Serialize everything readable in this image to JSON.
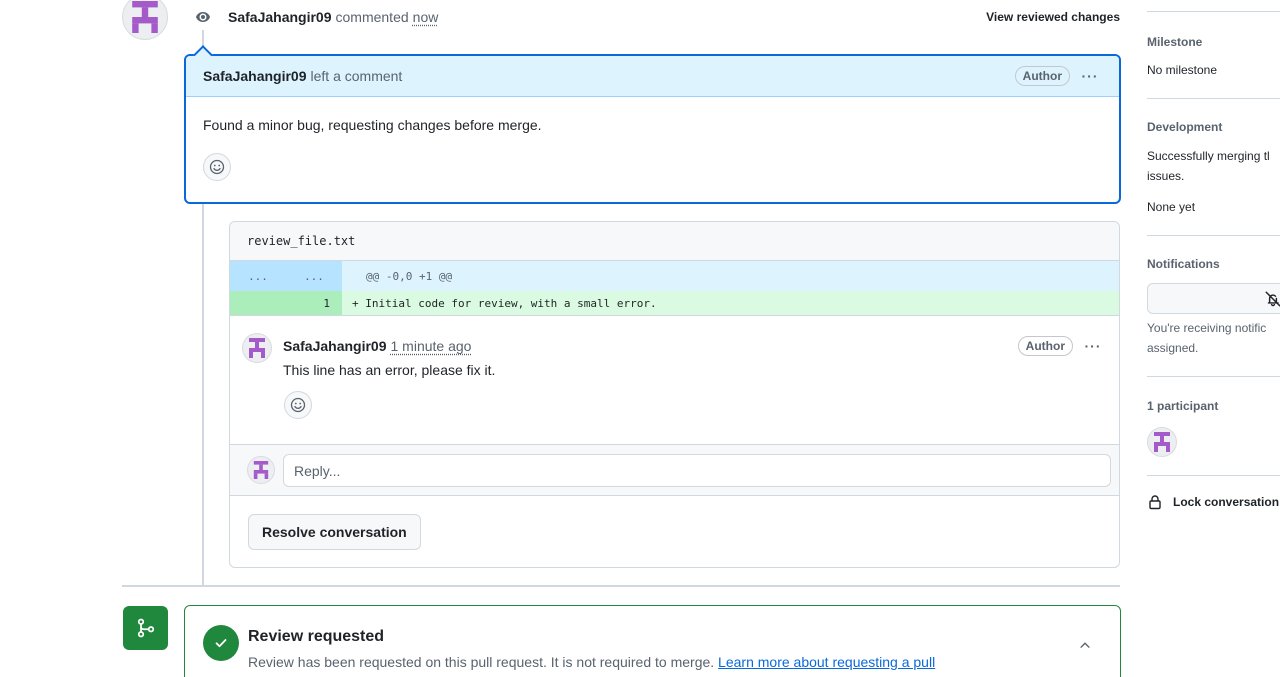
{
  "timeline_event": {
    "author": "SafaJahangir09",
    "action": "commented",
    "time": "now",
    "view_changes_label": "View reviewed changes",
    "icon": "eye-icon"
  },
  "review_comment": {
    "author": "SafaJahangir09",
    "action": "left a comment",
    "badge": "Author",
    "more_label": "···",
    "body": "Found a minor bug, requesting changes before merge."
  },
  "file": {
    "name": "review_file.txt",
    "hunk": {
      "left_num": "...",
      "right_num": "...",
      "header": "@@ -0,0 +1 @@"
    },
    "lines": [
      {
        "left_num": "",
        "right_num": "1",
        "code": "+ Initial code for review, with a small error."
      }
    ]
  },
  "thread_comment": {
    "author": "SafaJahangir09",
    "time": "1 minute ago",
    "badge": "Author",
    "more_label": "···",
    "body": "This line has an error, please fix it."
  },
  "reply": {
    "placeholder": "Reply..."
  },
  "resolve_label": "Resolve conversation",
  "review_requested": {
    "title": "Review requested",
    "description": "Review has been requested on this pull request. It is not required to merge.",
    "link_text": "Learn more about requesting a pull"
  },
  "sidebar": {
    "milestone": {
      "heading": "Milestone",
      "value": "No milestone"
    },
    "development": {
      "heading": "Development",
      "text_line1": "Successfully merging tl",
      "text_line2": "issues.",
      "value": "None yet"
    },
    "notifications": {
      "heading": "Notifications",
      "text_line1": "You're receiving notific",
      "text_line2": "assigned."
    },
    "participants": {
      "heading": "1 participant"
    },
    "lock_label": "Lock conversation"
  },
  "colors": {
    "accent_blue": "#0969da",
    "success_green": "#1f883d",
    "identicon_purple": "#a45ac9"
  }
}
